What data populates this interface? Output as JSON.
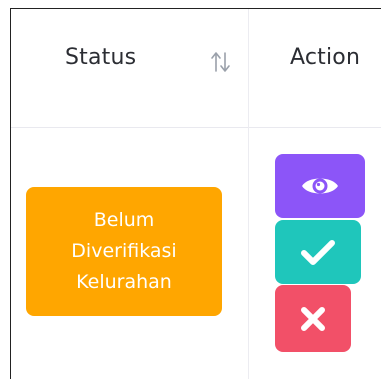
{
  "table": {
    "headers": {
      "status": "Status",
      "action": "Action"
    },
    "row": {
      "status_badge": "Belum Diverifikasi Kelurahan",
      "badge_color": "#ffa600"
    },
    "actions": [
      {
        "icon": "eye-icon",
        "color": "#8c55f8"
      },
      {
        "icon": "check-icon",
        "color": "#1fc6bb"
      },
      {
        "icon": "close-icon",
        "color": "#f25068"
      }
    ],
    "sort_icon": "sort-arrows-icon"
  }
}
